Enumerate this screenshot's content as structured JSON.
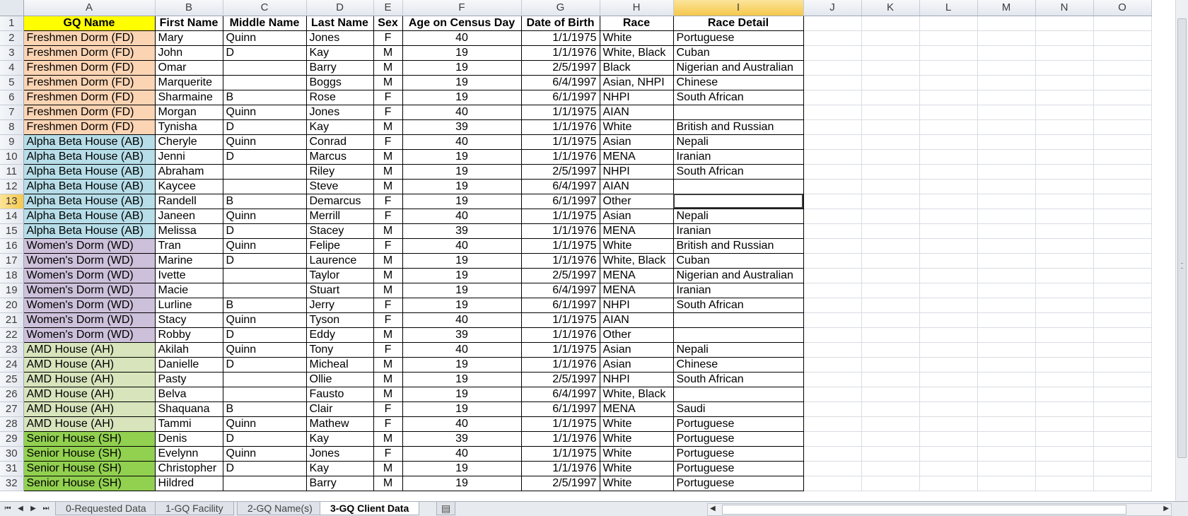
{
  "columns": [
    "A",
    "B",
    "C",
    "D",
    "E",
    "F",
    "G",
    "H",
    "I",
    "J",
    "K",
    "L",
    "M",
    "N",
    "O"
  ],
  "selected_column": "I",
  "selected_row": 13,
  "header": [
    "GQ Name",
    "First Name",
    "Middle Name",
    "Last Name",
    "Sex",
    "Age on Census Day",
    "Date of Birth",
    "Race",
    "Race Detail"
  ],
  "rows": [
    [
      "fd",
      "Freshmen Dorm (FD)",
      "Mary",
      "Quinn",
      "Jones",
      "F",
      "40",
      "1/1/1975",
      "White",
      "Portuguese"
    ],
    [
      "fd",
      "Freshmen Dorm (FD)",
      "John",
      "D",
      "Kay",
      "M",
      "19",
      "1/1/1976",
      "White, Black",
      "Cuban"
    ],
    [
      "fd",
      "Freshmen Dorm (FD)",
      "Omar",
      "",
      "Barry",
      "M",
      "19",
      "2/5/1997",
      "Black",
      "Nigerian and Australian"
    ],
    [
      "fd",
      "Freshmen Dorm (FD)",
      "Marquerite",
      "",
      "Boggs",
      "M",
      "19",
      "6/4/1997",
      "Asian, NHPI",
      "Chinese"
    ],
    [
      "fd",
      "Freshmen Dorm (FD)",
      "Sharmaine",
      "B",
      "Rose",
      "F",
      "19",
      "6/1/1997",
      "NHPI",
      "South African"
    ],
    [
      "fd",
      "Freshmen Dorm (FD)",
      "Morgan",
      "Quinn",
      "Jones",
      "F",
      "40",
      "1/1/1975",
      "AIAN",
      ""
    ],
    [
      "fd",
      "Freshmen Dorm (FD)",
      "Tynisha",
      "D",
      "Kay",
      "M",
      "39",
      "1/1/1976",
      "White",
      "British and Russian"
    ],
    [
      "ab",
      "Alpha Beta House (AB)",
      "Cheryle",
      "Quinn",
      "Conrad",
      "F",
      "40",
      "1/1/1975",
      "Asian",
      "Nepali"
    ],
    [
      "ab",
      "Alpha Beta House (AB)",
      "Jenni",
      "D",
      "Marcus",
      "M",
      "19",
      "1/1/1976",
      "MENA",
      "Iranian"
    ],
    [
      "ab",
      "Alpha Beta House (AB)",
      "Abraham",
      "",
      "Riley",
      "M",
      "19",
      "2/5/1997",
      "NHPI",
      "South African"
    ],
    [
      "ab",
      "Alpha Beta House (AB)",
      "Kaycee",
      "",
      "Steve",
      "M",
      "19",
      "6/4/1997",
      "AIAN",
      ""
    ],
    [
      "ab",
      "Alpha Beta House (AB)",
      "Randell",
      "B",
      "Demarcus",
      "F",
      "19",
      "6/1/1997",
      "Other",
      ""
    ],
    [
      "ab",
      "Alpha Beta House (AB)",
      "Janeen",
      "Quinn",
      "Merrill",
      "F",
      "40",
      "1/1/1975",
      "Asian",
      "Nepali"
    ],
    [
      "ab",
      "Alpha Beta House (AB)",
      "Melissa",
      "D",
      "Stacey",
      "M",
      "39",
      "1/1/1976",
      "MENA",
      "Iranian"
    ],
    [
      "wd",
      "Women's Dorm (WD)",
      "Tran",
      "Quinn",
      "Felipe",
      "F",
      "40",
      "1/1/1975",
      "White",
      "British and Russian"
    ],
    [
      "wd",
      "Women's Dorm (WD)",
      "Marine",
      "D",
      "Laurence",
      "M",
      "19",
      "1/1/1976",
      "White, Black",
      "Cuban"
    ],
    [
      "wd",
      "Women's Dorm (WD)",
      "Ivette",
      "",
      "Taylor",
      "M",
      "19",
      "2/5/1997",
      "MENA",
      "Nigerian and Australian"
    ],
    [
      "wd",
      "Women's Dorm (WD)",
      "Macie",
      "",
      "Stuart",
      "M",
      "19",
      "6/4/1997",
      "MENA",
      "Iranian"
    ],
    [
      "wd",
      "Women's Dorm (WD)",
      "Lurline",
      "B",
      "Jerry",
      "F",
      "19",
      "6/1/1997",
      "NHPI",
      "South African"
    ],
    [
      "wd",
      "Women's Dorm (WD)",
      "Stacy",
      "Quinn",
      "Tyson",
      "F",
      "40",
      "1/1/1975",
      "AIAN",
      ""
    ],
    [
      "wd",
      "Women's Dorm (WD)",
      "Robby",
      "D",
      "Eddy",
      "M",
      "39",
      "1/1/1976",
      "Other",
      ""
    ],
    [
      "ah",
      "AMD House (AH)",
      "Akilah",
      "Quinn",
      "Tony",
      "F",
      "40",
      "1/1/1975",
      "Asian",
      "Nepali"
    ],
    [
      "ah",
      "AMD House (AH)",
      "Danielle",
      "D",
      "Micheal",
      "M",
      "19",
      "1/1/1976",
      "Asian",
      "Chinese"
    ],
    [
      "ah",
      "AMD House (AH)",
      "Pasty",
      "",
      "Ollie",
      "M",
      "19",
      "2/5/1997",
      "NHPI",
      "South African"
    ],
    [
      "ah",
      "AMD House (AH)",
      "Belva",
      "",
      "Fausto",
      "M",
      "19",
      "6/4/1997",
      "White, Black",
      ""
    ],
    [
      "ah",
      "AMD House (AH)",
      "Shaquana",
      "B",
      "Clair",
      "F",
      "19",
      "6/1/1997",
      "MENA",
      "Saudi"
    ],
    [
      "ah",
      "AMD House (AH)",
      "Tammi",
      "Quinn",
      "Mathew",
      "F",
      "40",
      "1/1/1975",
      "White",
      "Portuguese"
    ],
    [
      "sh",
      "Senior House (SH)",
      "Denis",
      "D",
      "Kay",
      "M",
      "39",
      "1/1/1976",
      "White",
      "Portuguese"
    ],
    [
      "sh",
      "Senior House (SH)",
      "Evelynn",
      "Quinn",
      "Jones",
      "F",
      "40",
      "1/1/1975",
      "White",
      "Portuguese"
    ],
    [
      "sh",
      "Senior House (SH)",
      "Christopher",
      "D",
      "Kay",
      "M",
      "19",
      "1/1/1976",
      "White",
      "Portuguese"
    ],
    [
      "sh",
      "Senior House (SH)",
      "Hildred",
      "",
      "Barry",
      "M",
      "19",
      "2/5/1997",
      "White",
      "Portuguese"
    ]
  ],
  "tabs": [
    "0-Requested Data",
    "1-GQ Facility",
    "2-GQ Name(s)",
    "3-GQ Client Data"
  ],
  "active_tab": "3-GQ Client Data",
  "group_colors": {
    "fd": "#fbd4b4",
    "ab": "#b6dde8",
    "wd": "#ccc0da",
    "ah": "#d7e4bc",
    "sh": "#92d050",
    "header_a": "#ffff00",
    "selection": "#f5c84c"
  }
}
